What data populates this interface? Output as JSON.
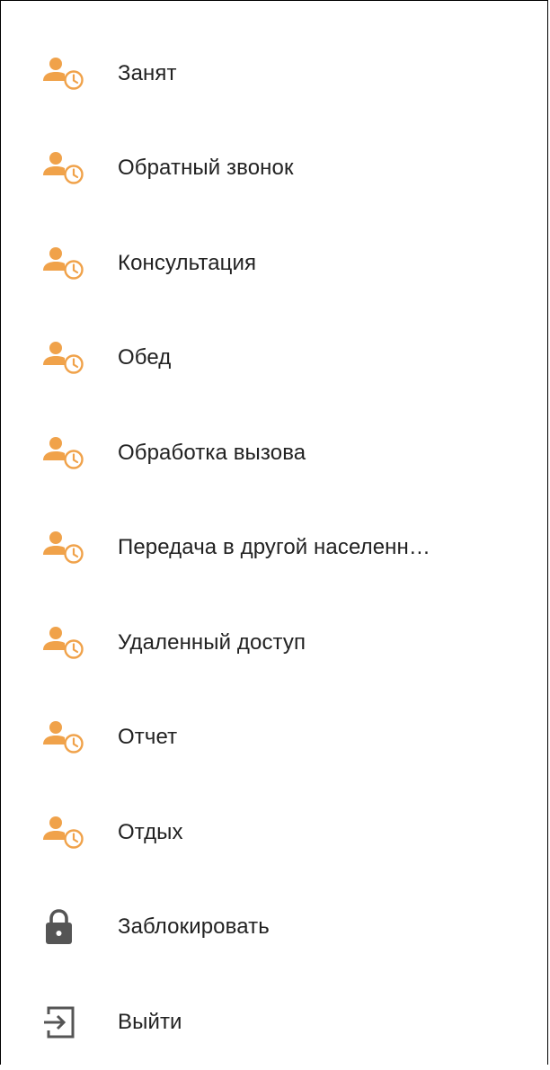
{
  "colors": {
    "status_icon": "#F0A24A",
    "system_icon": "#555555",
    "text": "#222222",
    "border": "#000000"
  },
  "menu": {
    "items": [
      {
        "label": "Занят",
        "icon": "user-clock-icon"
      },
      {
        "label": "Обратный звонок",
        "icon": "user-clock-icon"
      },
      {
        "label": "Консультация",
        "icon": "user-clock-icon"
      },
      {
        "label": "Обед",
        "icon": "user-clock-icon"
      },
      {
        "label": "Обработка вызова",
        "icon": "user-clock-icon"
      },
      {
        "label": "Передача в другой населенн…",
        "icon": "user-clock-icon"
      },
      {
        "label": "Удаленный доступ",
        "icon": "user-clock-icon"
      },
      {
        "label": "Отчет",
        "icon": "user-clock-icon"
      },
      {
        "label": "Отдых",
        "icon": "user-clock-icon"
      },
      {
        "label": "Заблокировать",
        "icon": "lock-icon"
      },
      {
        "label": "Выйти",
        "icon": "logout-icon"
      }
    ]
  }
}
